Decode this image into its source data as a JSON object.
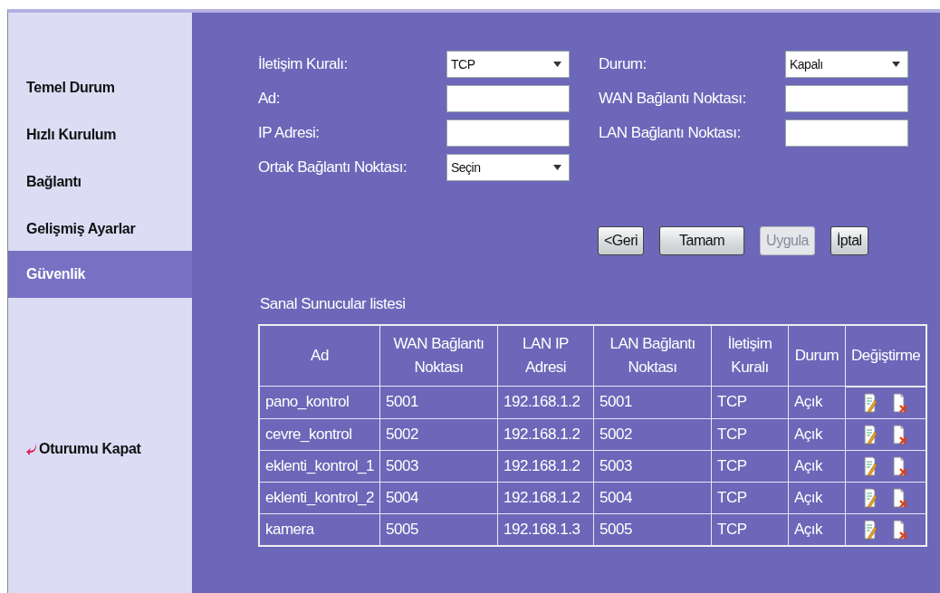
{
  "sidebar": {
    "items": [
      {
        "label": "Temel Durum",
        "selected": false
      },
      {
        "label": "Hızlı Kurulum",
        "selected": false
      },
      {
        "label": "Bağlantı",
        "selected": false
      },
      {
        "label": "Gelişmiş Ayarlar",
        "selected": false
      },
      {
        "label": "Güvenlik",
        "selected": true
      }
    ],
    "logout": {
      "label": "Oturumu Kapat"
    }
  },
  "form": {
    "left": [
      {
        "label": "İletişim Kuralı:",
        "kind": "select",
        "value": "TCP"
      },
      {
        "label": "Ad:",
        "kind": "text"
      },
      {
        "label": "IP Adresi:",
        "kind": "text"
      },
      {
        "label": "Ortak Bağlantı Noktası:",
        "kind": "select",
        "value": "Seçin"
      }
    ],
    "right": [
      {
        "label": "Durum:",
        "kind": "select",
        "value": "Kapalı"
      },
      {
        "label": "WAN Bağlantı Noktası:",
        "kind": "text"
      },
      {
        "label": "LAN Bağlantı Noktası:",
        "kind": "text"
      }
    ]
  },
  "buttons": [
    {
      "label": "<Geri",
      "disabled": false
    },
    {
      "label": "Tamam",
      "disabled": false
    },
    {
      "label": "Uygula",
      "disabled": true
    },
    {
      "label": "İptal",
      "disabled": false
    }
  ],
  "table": {
    "title": "Sanal Sunucular listesi",
    "columns": [
      "Ad",
      "WAN Bağlantı Noktası",
      "LAN IP Adresi",
      "LAN Bağlantı Noktası",
      "İletişim Kuralı",
      "Durum",
      "Değiştirme"
    ],
    "rows": [
      [
        "pano_kontrol",
        "5001",
        "192.168.1.2",
        "5001",
        "TCP",
        "Açık"
      ],
      [
        "cevre_kontrol",
        "5002",
        "192.168.1.2",
        "5002",
        "TCP",
        "Açık"
      ],
      [
        "eklenti_kontrol_1",
        "5003",
        "192.168.1.2",
        "5003",
        "TCP",
        "Açık"
      ],
      [
        "eklenti_kontrol_2",
        "5004",
        "192.168.1.2",
        "5004",
        "TCP",
        "Açık"
      ],
      [
        "kamera",
        "5005",
        "192.168.1.3",
        "5005",
        "TCP",
        "Açık"
      ]
    ]
  }
}
